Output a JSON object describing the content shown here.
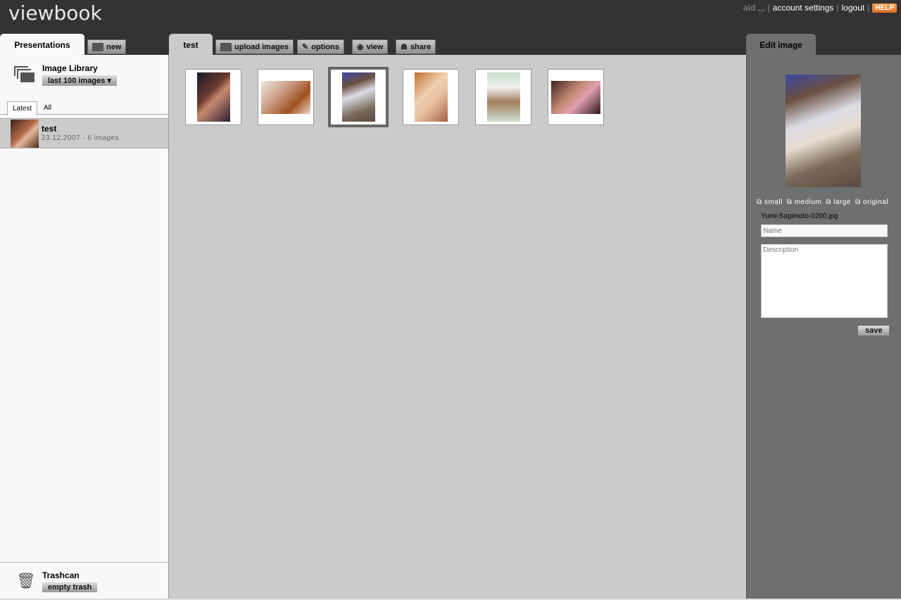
{
  "header": {
    "logo": "viewbook",
    "user": "aid ,,,",
    "account_settings": "account settings",
    "logout": "logout",
    "help": "HELP"
  },
  "left": {
    "tab": "Presentations",
    "new_button": "new",
    "library_title": "Image Library",
    "library_filter": "last 100 images ▾",
    "subtabs": [
      "Latest",
      "All"
    ],
    "presentations": [
      {
        "title": "test",
        "meta": "23.12.2007 - 6 images"
      }
    ],
    "trash_title": "Trashcan",
    "empty_trash": "empty trash"
  },
  "main": {
    "tab": "test",
    "toolbar": {
      "upload": "upload images",
      "options": "options",
      "view": "view",
      "share": "share"
    },
    "thumbnails": [
      {
        "orientation": "portrait",
        "selected": false
      },
      {
        "orientation": "landscape",
        "selected": false
      },
      {
        "orientation": "portrait",
        "selected": true
      },
      {
        "orientation": "portrait",
        "selected": false
      },
      {
        "orientation": "portrait",
        "selected": false
      },
      {
        "orientation": "landscape",
        "selected": false
      }
    ]
  },
  "edit": {
    "tab": "Edit image",
    "sizes": [
      "small",
      "medium",
      "large",
      "original"
    ],
    "filename": "Yumi-Sugimoto-0200.jpg",
    "name_placeholder": "Name",
    "description_placeholder": "Description",
    "save": "save"
  }
}
